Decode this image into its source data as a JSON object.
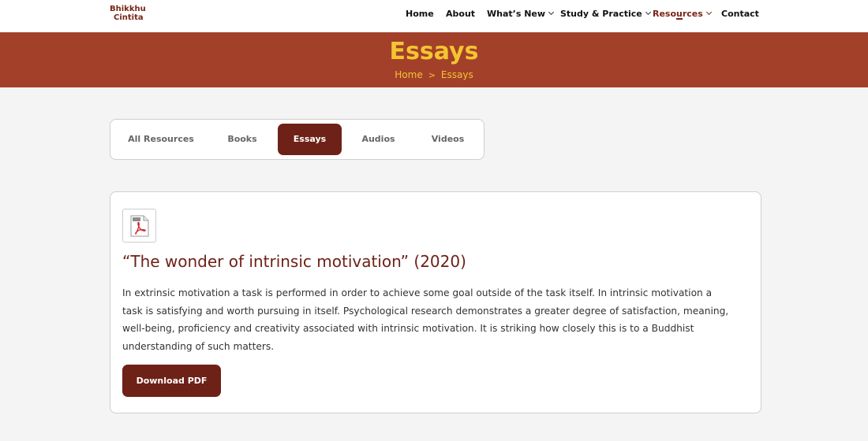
{
  "site": {
    "logo_line1": "Bhikkhu",
    "logo_line2": "Cintita"
  },
  "nav": {
    "items": [
      {
        "label": "Home"
      },
      {
        "label": "About"
      },
      {
        "label": "What’s New"
      },
      {
        "label": "Study & Practice"
      },
      {
        "label": "Resources"
      },
      {
        "label": "Contact"
      }
    ],
    "active": "Resources"
  },
  "banner": {
    "title": "Essays",
    "breadcrumb": {
      "home": "Home",
      "separator": ">",
      "current": "Essays"
    }
  },
  "tabs": {
    "items": [
      {
        "label": "All Resources"
      },
      {
        "label": "Books"
      },
      {
        "label": "Essays"
      },
      {
        "label": "Audios"
      },
      {
        "label": "Videos"
      }
    ],
    "active": "Essays"
  },
  "essay": {
    "icon": "pdf-file-icon",
    "title": "“The wonder of intrinsic motivation” (2020)",
    "description": "In extrinsic motivation a task is performed in order to achieve some goal outside of the task itself. In intrinsic motivation a task is satisfying and worth pursuing in itself. Psychological research demonstrates a greater degree of satisfaction, meaning, well-being, proficiency and creativity associated with intrinsic motivation. It is striking how closely this is to a Buddhist understanding of such matters.",
    "button_label": "Download PDF"
  },
  "colors": {
    "brand": "#6e2117",
    "banner": "#a3402a",
    "accent_yellow": "#f4c531"
  }
}
